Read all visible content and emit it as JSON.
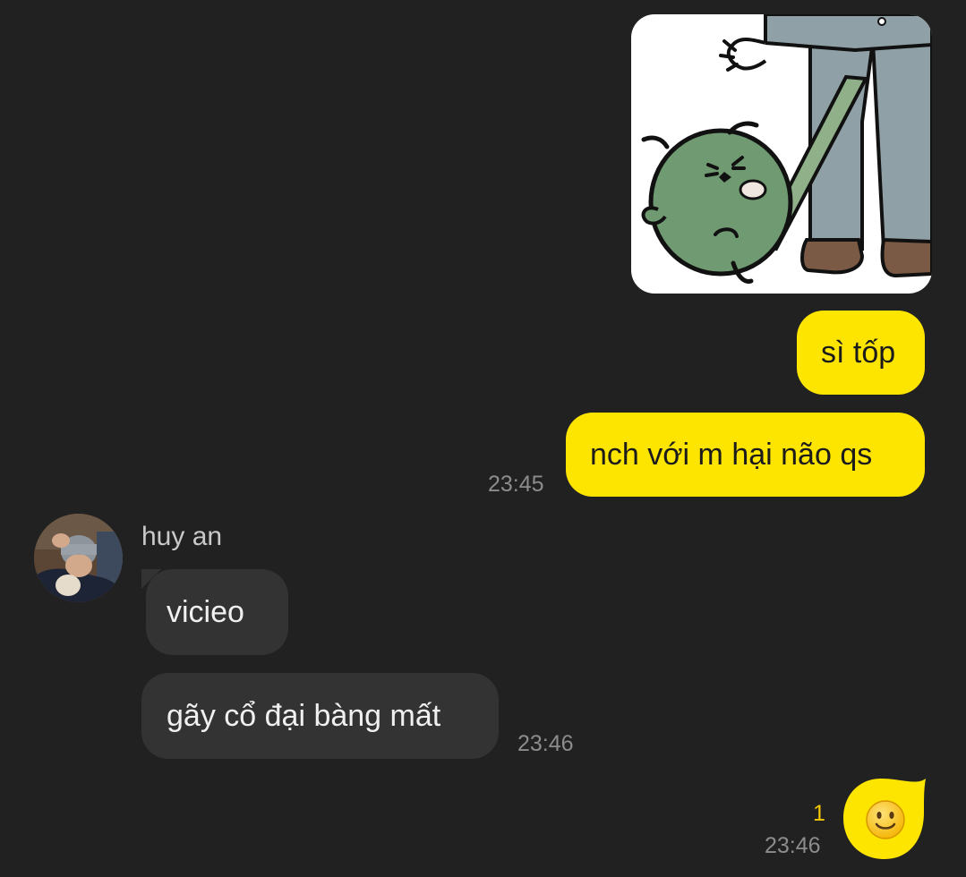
{
  "colors": {
    "background": "#212121",
    "outgoing_bubble": "#fee500",
    "incoming_bubble": "#333333",
    "timestamp": "#8c8c8c",
    "unread_count": "#f5c800"
  },
  "outgoing_messages": [
    {
      "text": "sì tốp"
    },
    {
      "text": "nch với m hại não qs",
      "time": "23:45"
    }
  ],
  "incoming": {
    "sender_name": "huy an",
    "messages": [
      {
        "text": "vicieo"
      },
      {
        "text": "gãy cổ đại bàng mất",
        "time": "23:46"
      }
    ]
  },
  "last_outgoing": {
    "emoji": "slightly-smiling-face-emoji",
    "unread_count": "1",
    "time": "23:46"
  },
  "sticker": {
    "icon": "sticker-image"
  }
}
